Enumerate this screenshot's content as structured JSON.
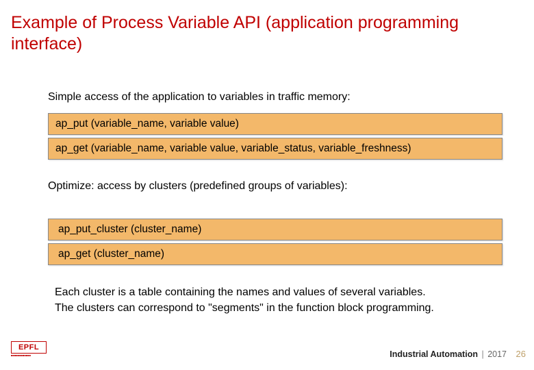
{
  "title": "Example of Process Variable API (application programming interface)",
  "intro": "Simple access of the application to variables in traffic memory:",
  "api1": "ap_put (variable_name, variable value)",
  "api2": "ap_get (variable_name, variable value, variable_status, variable_freshness)",
  "optimize": "Optimize: access by clusters (predefined groups of variables):",
  "api3": "ap_put_cluster (cluster_name)",
  "api4": "ap_get (cluster_name)",
  "note1": "Each cluster is a table containing the names and values of several variables.",
  "note2": "The clusters can correspond to \"segments\" in the function block programming.",
  "logo_text": "EPFL",
  "footer_course": "Industrial Automation",
  "footer_sep": "|",
  "footer_year": "2017",
  "page_number": "26"
}
